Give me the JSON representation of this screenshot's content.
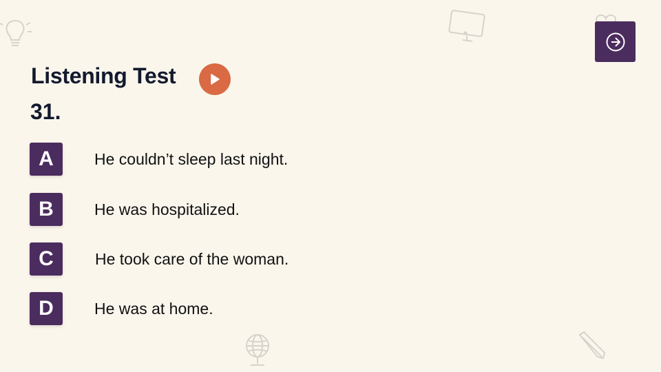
{
  "header": {
    "title": "Listening Test",
    "question_number": "31."
  },
  "colors": {
    "background": "#faf6ec",
    "accent_purple": "#4b2c5e",
    "play_orange": "#d96a43",
    "heading_text": "#131a2e"
  },
  "options": [
    {
      "letter": "A",
      "text": "He couldn’t sleep last night."
    },
    {
      "letter": "B",
      "text": "He was hospitalized."
    },
    {
      "letter": "C",
      "text": "He took care of the woman."
    },
    {
      "letter": "D",
      "text": "He was at home."
    }
  ],
  "icons": {
    "next": "arrow-right-circle-icon",
    "play": "play-icon",
    "decorations": [
      "lightbulb-icon",
      "monitor-icon",
      "heart-icon",
      "globe-icon",
      "pencil-icon"
    ]
  }
}
